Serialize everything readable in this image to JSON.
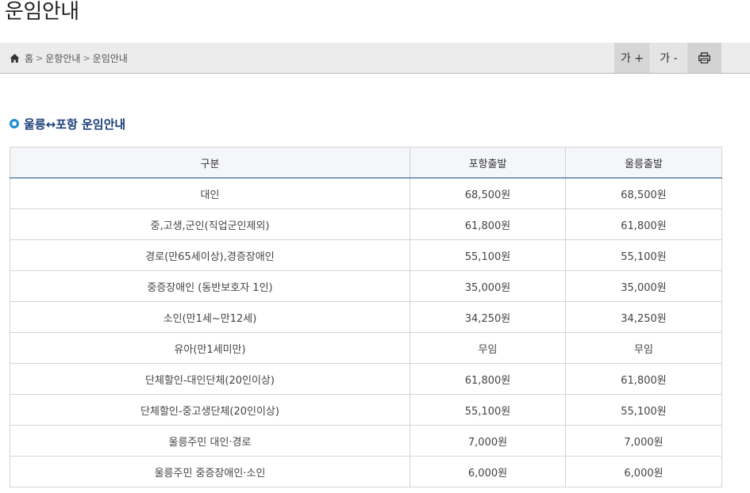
{
  "page": {
    "title": "운임안내"
  },
  "breadcrumb": {
    "items": [
      "홈",
      "운항안내",
      "운임안내"
    ],
    "separator": ">"
  },
  "tools": {
    "zoom_in_label": "가 +",
    "zoom_out_label": "가 -",
    "print_icon": "printer-icon"
  },
  "section": {
    "title": "울릉↔포항 운임안내",
    "bullet_color": "#1f8fd1"
  },
  "fare_table": {
    "headers": [
      "구분",
      "포항출발",
      "울릉출발"
    ],
    "rows": [
      [
        "대인",
        "68,500원",
        "68,500원"
      ],
      [
        "중,고생,군인(직업군인제외)",
        "61,800원",
        "61,800원"
      ],
      [
        "경로(만65세이상),경증장애인",
        "55,100원",
        "55,100원"
      ],
      [
        "중증장애인 (동반보호자 1인)",
        "35,000원",
        "35,000원"
      ],
      [
        "소인(만1세~만12세)",
        "34,250원",
        "34,250원"
      ],
      [
        "유아(만1세미만)",
        "무임",
        "무임"
      ],
      [
        "단체할인-대인단체(20인이상)",
        "61,800원",
        "61,800원"
      ],
      [
        "단체할인-중고생단체(20인이상)",
        "55,100원",
        "55,100원"
      ],
      [
        "울릉주민 대인·경로",
        "7,000원",
        "7,000원"
      ],
      [
        "울릉주민 중증장애인·소인",
        "6,000원",
        "6,000원"
      ]
    ]
  },
  "colors": {
    "accent": "#1d4e8f",
    "topbar_bg": "#ececec"
  }
}
